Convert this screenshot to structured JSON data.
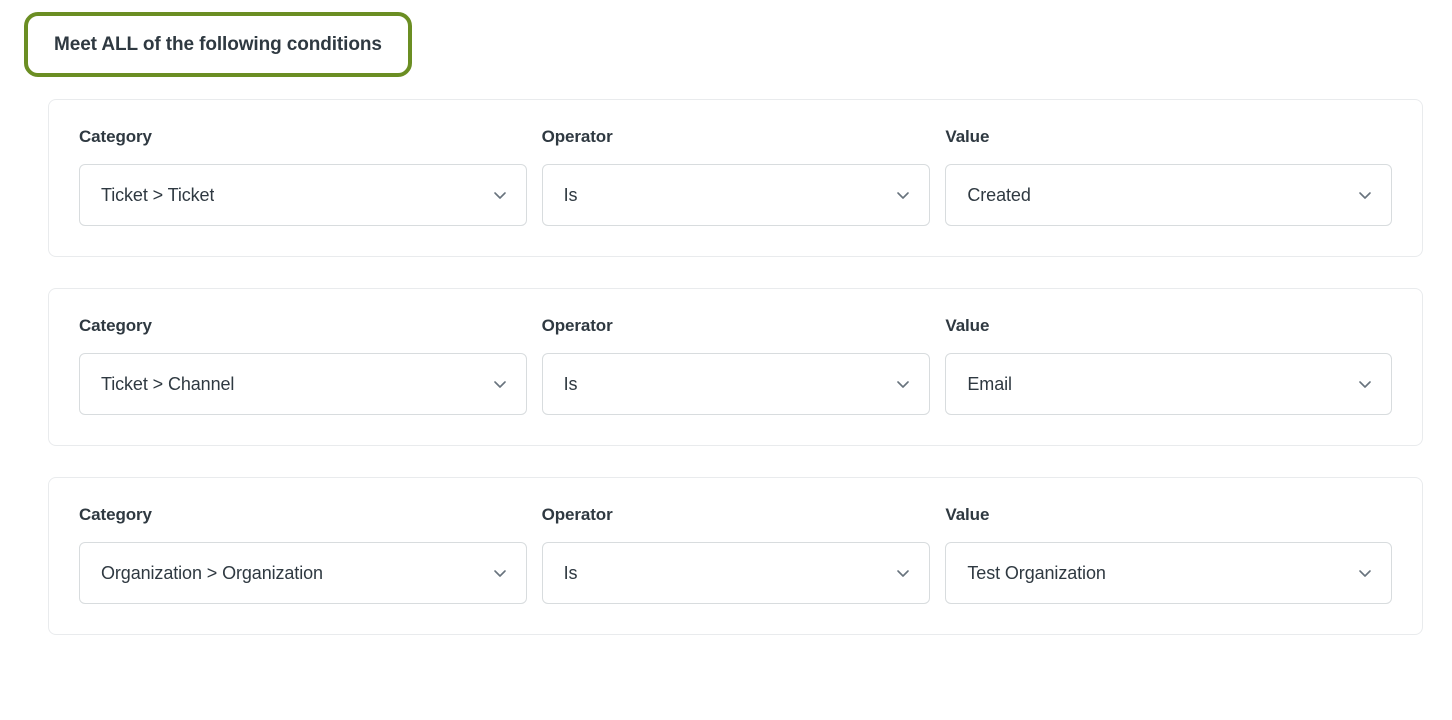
{
  "header": {
    "title": "Meet ALL of the following conditions",
    "highlight_color": "#6b8e23"
  },
  "labels": {
    "category": "Category",
    "operator": "Operator",
    "value": "Value"
  },
  "icons": {
    "chevron": "chevron-down-icon"
  },
  "conditions": [
    {
      "category": "Ticket > Ticket",
      "operator": "Is",
      "value": "Created"
    },
    {
      "category": "Ticket > Channel",
      "operator": "Is",
      "value": "Email"
    },
    {
      "category": "Organization > Organization",
      "operator": "Is",
      "value": "Test Organization"
    }
  ]
}
